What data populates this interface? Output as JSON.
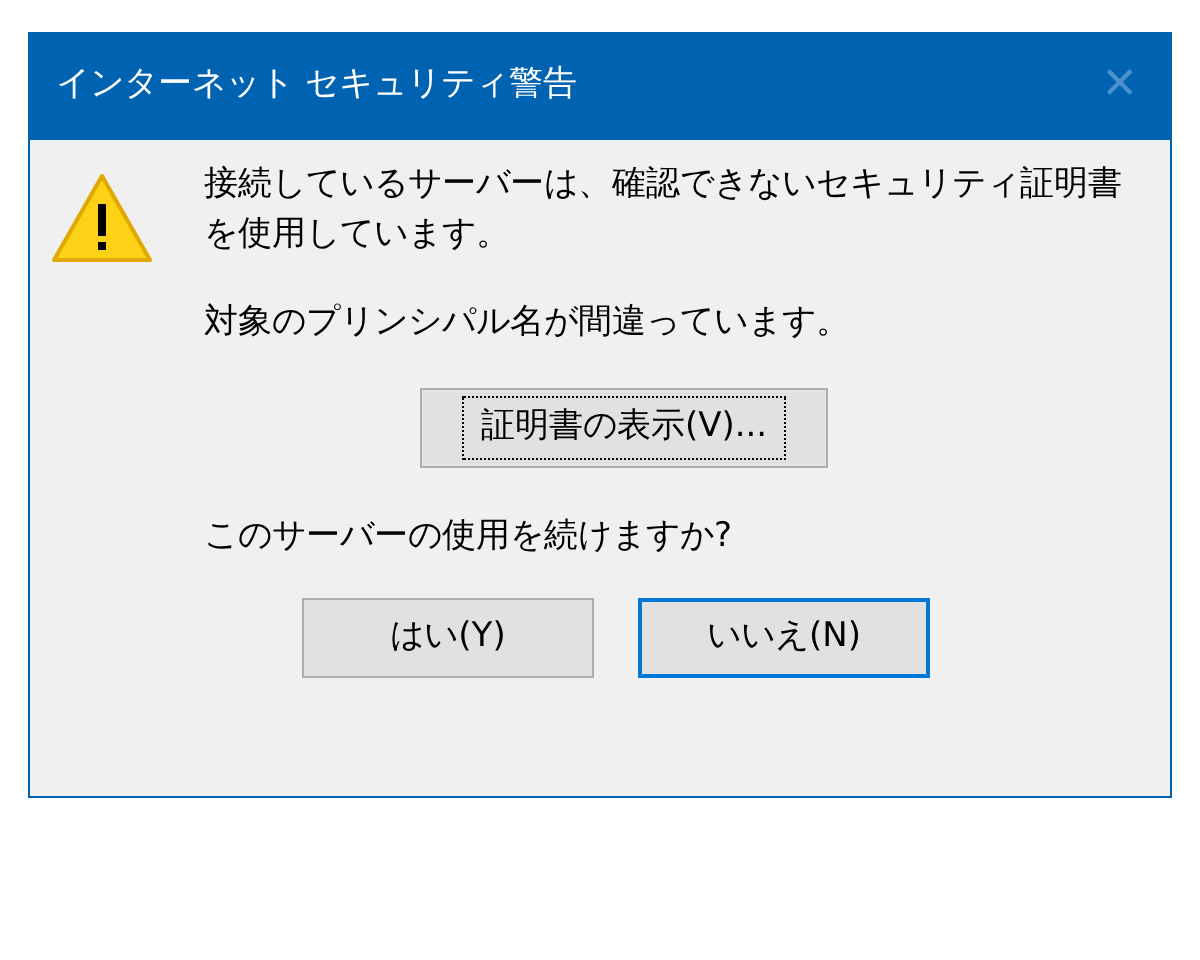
{
  "window": {
    "title": "インターネット セキュリティ警告",
    "close": "✕"
  },
  "message": "接続しているサーバーは、確認できないセキュリティ証明書を使用しています。",
  "detail": "対象のプリンシパル名が間違っています。",
  "view_button": {
    "label": "証明書の表示(V)...",
    "focused": true,
    "default": false
  },
  "question": "このサーバーの使用を続けますか?",
  "buttons": [
    {
      "label": "はい(Y)",
      "focused": false,
      "default": false
    },
    {
      "label": "いいえ(N)",
      "focused": false,
      "default": true
    }
  ]
}
